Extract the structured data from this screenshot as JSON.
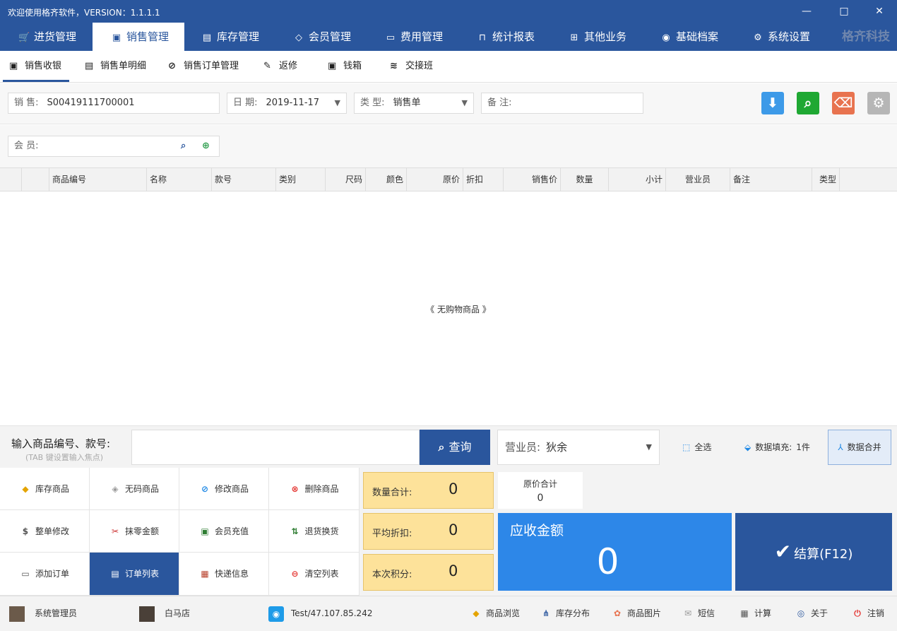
{
  "window": {
    "title": "欢迎使用格齐软件，VERSION：1.1.1.1",
    "min": "—",
    "max": "□",
    "close": "✕"
  },
  "main_tabs": [
    {
      "label": "进货管理",
      "icon": "cart-icon"
    },
    {
      "label": "销售管理",
      "icon": "bag-icon"
    },
    {
      "label": "库存管理",
      "icon": "warehouse-icon"
    },
    {
      "label": "会员管理",
      "icon": "diamond-icon"
    },
    {
      "label": "费用管理",
      "icon": "money-icon"
    },
    {
      "label": "统计报表",
      "icon": "report-icon"
    },
    {
      "label": "其他业务",
      "icon": "grid-icon"
    },
    {
      "label": "基础档案",
      "icon": "pin-icon"
    },
    {
      "label": "系统设置",
      "icon": "gear-icon"
    }
  ],
  "brand": "格齐科技",
  "sub_tabs": [
    {
      "label": "销售收银",
      "icon": "bag-icon"
    },
    {
      "label": "销售单明细",
      "icon": "doc-icon"
    },
    {
      "label": "销售订单管理",
      "icon": "paperclip-icon"
    },
    {
      "label": "返修",
      "icon": "wrench-icon"
    },
    {
      "label": "钱箱",
      "icon": "cashbox-icon"
    },
    {
      "label": "交接班",
      "icon": "shift-icon"
    }
  ],
  "form": {
    "sale_label": "销 售:",
    "sale_value": "S00419111700001",
    "date_label": "日 期:",
    "date_value": "2019-11-17",
    "type_label": "类 型:",
    "type_value": "销售单",
    "note_label": "备 注:",
    "note_value": "",
    "member_label": "会 员:",
    "member_value": ""
  },
  "toolbar": {
    "colors": {
      "download": "#3d9ae8",
      "search": "#1fa833",
      "eraser": "#e8734f",
      "settings": "#b6b6b6"
    }
  },
  "grid": {
    "columns": [
      "商品编号",
      "名称",
      "款号",
      "类别",
      "尺码",
      "颜色",
      "原价",
      "折扣",
      "销售价",
      "数量",
      "小计",
      "营业员",
      "备注",
      "类型"
    ],
    "empty_text": "《 无购物商品 》"
  },
  "input": {
    "label": "输入商品编号、款号:",
    "hint": "(TAB 键设置输入焦点)",
    "value": "",
    "query_label": "查询",
    "salesman_label": "营业员:",
    "salesman_value": "狄余",
    "select_all": "全选",
    "fill_label": "数据填充:",
    "fill_value": "1件",
    "merge": "数据合并"
  },
  "actions": [
    {
      "label": "库存商品",
      "icon": "stock-icon",
      "color": "#e4a400"
    },
    {
      "label": "无码商品",
      "icon": "tag-icon",
      "color": "#999999"
    },
    {
      "label": "修改商品",
      "icon": "edit-icon",
      "color": "#1e88e5"
    },
    {
      "label": "删除商品",
      "icon": "delete-icon",
      "color": "#e53935"
    },
    {
      "label": "整单修改",
      "icon": "dollar-icon",
      "color": "#555555"
    },
    {
      "label": "抹零金额",
      "icon": "scissors-icon",
      "color": "#cc3333"
    },
    {
      "label": "会员充值",
      "icon": "recharge-icon",
      "color": "#2e7d32"
    },
    {
      "label": "退货换货",
      "icon": "exchange-icon",
      "color": "#2e7d32"
    },
    {
      "label": "添加订单",
      "icon": "add-order-icon",
      "color": "#555555"
    },
    {
      "label": "订单列表",
      "icon": "order-list-icon",
      "color": "#ffffff"
    },
    {
      "label": "快递信息",
      "icon": "express-icon",
      "color": "#b8402b"
    },
    {
      "label": "清空列表",
      "icon": "clear-icon",
      "color": "#e53935"
    }
  ],
  "summary": {
    "qty_label": "数量合计:",
    "qty_value": "0",
    "discount_label": "平均折扣:",
    "discount_value": "0",
    "points_label": "本次积分:",
    "points_value": "0",
    "orig_label": "原价合计",
    "orig_value": "0",
    "receivable_label": "应收金额",
    "receivable_value": "0",
    "checkout_label": "结算(F12)"
  },
  "status": {
    "user": "系统管理员",
    "store": "白马店",
    "server": "Test/47.107.85.242",
    "links": [
      {
        "label": "商品浏览",
        "icon": "browse-icon",
        "color": "#e4a400"
      },
      {
        "label": "库存分布",
        "icon": "share-icon",
        "color": "#2a569d"
      },
      {
        "label": "商品图片",
        "icon": "image-icon",
        "color": "#e8734f"
      },
      {
        "label": "短信",
        "icon": "mail-icon",
        "color": "#999999"
      },
      {
        "label": "计算",
        "icon": "calculator-icon",
        "color": "#555555"
      },
      {
        "label": "关于",
        "icon": "about-icon",
        "color": "#2a569d"
      },
      {
        "label": "注销",
        "icon": "power-icon",
        "color": "#e53935"
      }
    ]
  }
}
